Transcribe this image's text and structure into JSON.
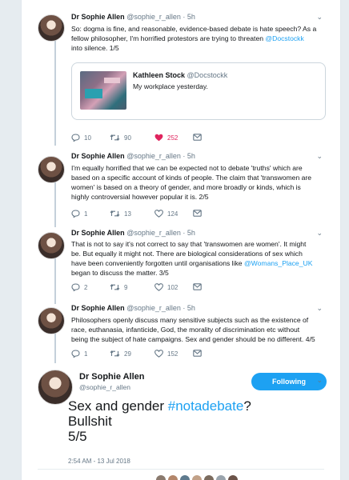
{
  "tweets": [
    {
      "name": "Dr Sophie Allen",
      "handle": "@sophie_r_allen",
      "sep": "·",
      "time": "5h",
      "lines": [
        "So: dogma is fine, and reasonable, evidence-based debate is hate speech? As a",
        "fellow philosopher, I'm horrified protestors are trying to threaten ",
        "@Docstockk",
        "into silence. 1/5"
      ],
      "quote": {
        "name": "Kathleen Stock",
        "handle": "@Docstockk",
        "text": "My workplace yesterday."
      },
      "replies": "10",
      "retweets": "90",
      "likes": "252"
    },
    {
      "name": "Dr Sophie Allen",
      "handle": "@sophie_r_allen",
      "sep": "·",
      "time": "5h",
      "lines": [
        "I'm equally horrified that we can be expected not to debate 'truths' which are",
        "based on a specific account of kinds of people. The claim that 'transwomen are",
        "women' is based on a theory of gender, and more broadly or kinds, which is",
        "highly controversial however popular it is. 2/5"
      ],
      "replies": "1",
      "retweets": "13",
      "likes": "124"
    },
    {
      "name": "Dr Sophie Allen",
      "handle": "@sophie_r_allen",
      "sep": "·",
      "time": "5h",
      "lines": [
        "That is not to say it's not correct to say that 'transwomen are women'. It might",
        "be. But equally it might not. There are biological considerations of sex which",
        "have been conveniently forgotten until organisations like ",
        "@Womans_Place_UK",
        "began to discuss the matter. 3/5"
      ],
      "replies": "2",
      "retweets": "9",
      "likes": "102"
    },
    {
      "name": "Dr Sophie Allen",
      "handle": "@sophie_r_allen",
      "sep": "·",
      "time": "5h",
      "lines": [
        "Philosophers openly discuss many sensitive subjects such as the existence of",
        "race, euthanasia, infanticide, God, the morality of discrimination etc without",
        "being the subject of hate campaigns. Sex and gender should be no different.  4/5"
      ],
      "replies": "1",
      "retweets": "29",
      "likes": "152"
    }
  ],
  "main": {
    "name": "Dr Sophie Allen",
    "handle": "@sophie_r_allen",
    "follow_label": "Following",
    "text_prefix": "Sex and gender ",
    "hashtag": "#notadebate",
    "text_suffix": "?",
    "line2": "Bullshit",
    "line3": "5/5",
    "timestamp": "2:54 AM - 13 Jul 2018"
  },
  "icons": {
    "reply": "reply-icon",
    "retweet": "retweet-icon",
    "like": "like-icon",
    "message": "message-icon",
    "more": "chevron-down-icon"
  },
  "colors": {
    "link": "#1da1f2",
    "like_active": "#e0245e",
    "muted": "#657786",
    "thread_line": "#c4d0da"
  }
}
